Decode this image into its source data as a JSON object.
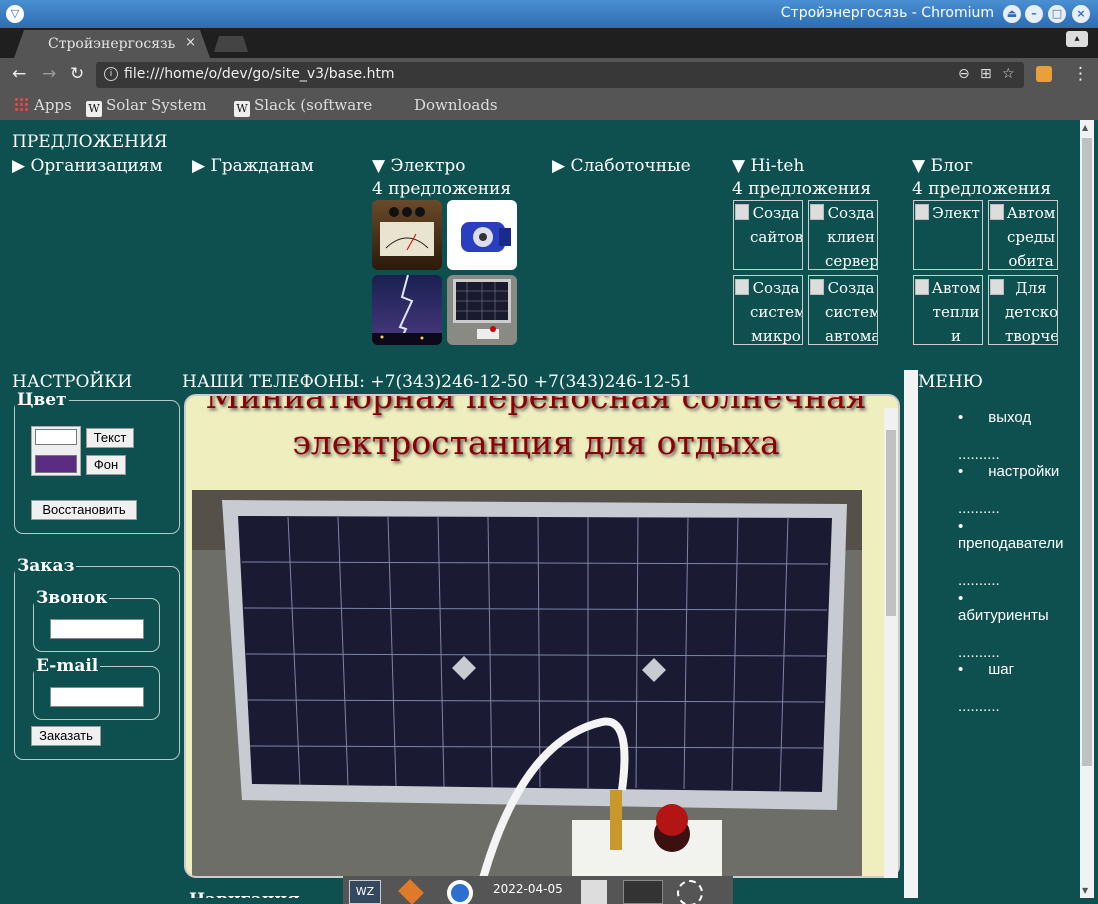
{
  "window": {
    "title": "Стройэнергосязь - Chromium"
  },
  "tab": {
    "title": "Стройэнергосязь",
    "close": "×"
  },
  "address": {
    "url": "file:///home/o/dev/go/site_v3/base.htm"
  },
  "bookmarks": [
    {
      "label": "Apps"
    },
    {
      "label": "Solar System -"
    },
    {
      "label": "Slack (software"
    },
    {
      "label": "Downloads"
    }
  ],
  "offers": {
    "heading": "ПРЕДЛОЖЕНИЯ",
    "groups": [
      {
        "label": "▶ Организациям"
      },
      {
        "label": "▶ Гражданам"
      },
      {
        "label": "▼ Электро",
        "count": "4 предложения"
      },
      {
        "label": "▶ Слаботочные"
      },
      {
        "label": "▼ Hi-teh",
        "count": "4 предложения",
        "items": [
          "Созда сайтов",
          "Созда клиен сервер",
          "Созда систем микро",
          "Созда систем автома"
        ]
      },
      {
        "label": "▼ Блог",
        "count": "4 предложения",
        "items": [
          "Элект",
          "Автом среды обита",
          "Автом тепли и",
          "Для детско творче"
        ]
      }
    ]
  },
  "settings": {
    "heading": "НАСТРОЙКИ",
    "color_legend": "Цвет",
    "text_btn": "Текст",
    "bg_btn": "Фон",
    "restore_btn": "Восстановить",
    "colors": {
      "text": "#ffffff",
      "background": "#5a2d82"
    },
    "order_legend": "Заказ",
    "call_legend": "Звонок",
    "email_legend": "E-mail",
    "order_btn": "Заказать"
  },
  "phones": "НАШИ ТЕЛЕФОНЫ: +7(343)246-12-50 +7(343)246-12-51",
  "article": {
    "title": "Миниатюрная переносная солнечная электростанция для отдыха"
  },
  "nav_legend": "Навигация",
  "menu": {
    "heading": "МЕНЮ",
    "items": [
      "выход",
      "настройки",
      "преподаватели",
      "абитуриенты",
      "шаг"
    ],
    "sep": ".........."
  },
  "taskbar": {
    "date": "2022-04-05"
  }
}
